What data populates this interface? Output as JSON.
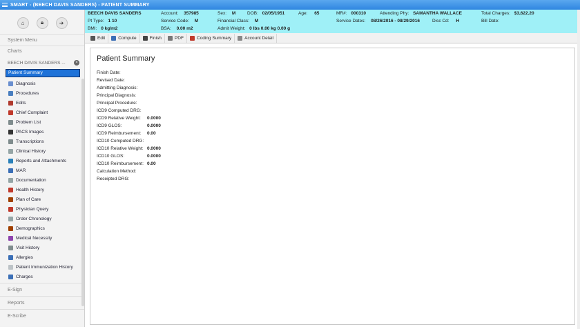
{
  "window": {
    "title": "SMART - (BEECH DAVIS SANDERS) - PATIENT SUMMARY"
  },
  "sidebar": {
    "system_menu": "System Menu",
    "charts": "Charts",
    "patient_name": "BEECH DAVIS SANDERS ...",
    "selected": "Patient Summary",
    "items": [
      {
        "label": "Diagnosis",
        "icon": "diagnosis-icon",
        "color": "#6a8fcf"
      },
      {
        "label": "Procedures",
        "icon": "procedures-icon",
        "color": "#4a7fc0"
      },
      {
        "label": "Edits",
        "icon": "edits-icon",
        "color": "#b03a2e"
      },
      {
        "label": "Chief Complaint",
        "icon": "chief-complaint-icon",
        "color": "#c0392b"
      },
      {
        "label": "Problem List",
        "icon": "problem-list-icon",
        "color": "#7f8c8d"
      },
      {
        "label": "PACS Images",
        "icon": "pacs-images-icon",
        "color": "#333333"
      },
      {
        "label": "Transcriptions",
        "icon": "transcriptions-icon",
        "color": "#7f8c8d"
      },
      {
        "label": "Clinical History",
        "icon": "clinical-history-icon",
        "color": "#95a5a6"
      },
      {
        "label": "Reports and Attachments",
        "icon": "reports-icon",
        "color": "#2980b9"
      },
      {
        "label": "MAR",
        "icon": "mar-icon",
        "color": "#3b6fb6"
      },
      {
        "label": "Documentation",
        "icon": "documentation-icon",
        "color": "#95a5a6"
      },
      {
        "label": "Health History",
        "icon": "health-history-icon",
        "color": "#c0392b"
      },
      {
        "label": "Plan of Care",
        "icon": "plan-of-care-icon",
        "color": "#a04000"
      },
      {
        "label": "Physician Query",
        "icon": "physician-query-icon",
        "color": "#c0392b"
      },
      {
        "label": "Order Chronology",
        "icon": "order-chronology-icon",
        "color": "#95a5a6"
      },
      {
        "label": "Demographics",
        "icon": "demographics-icon",
        "color": "#a04000"
      },
      {
        "label": "Medical Necessity",
        "icon": "medical-necessity-icon",
        "color": "#8e44ad"
      },
      {
        "label": "Visit History",
        "icon": "visit-history-icon",
        "color": "#7f8c8d"
      },
      {
        "label": "Allergies",
        "icon": "allergies-icon",
        "color": "#3b6fb6"
      },
      {
        "label": "Patient Immunization History",
        "icon": "immunization-icon",
        "color": "#bdc3c7"
      },
      {
        "label": "Charges",
        "icon": "charges-icon",
        "color": "#3b6fb6"
      }
    ],
    "bottom": [
      "E-Sign",
      "Reports",
      "E-Scribe"
    ]
  },
  "header": {
    "name": "BEECH DAVIS SANDERS",
    "account_label": "Account:",
    "account": "357985",
    "sex_label": "Sex:",
    "sex": "M",
    "dob_label": "DOB:",
    "dob": "02/05/1951",
    "age_label": "Age:",
    "age": "65",
    "mr_label": "MR#:",
    "mr": "000310",
    "attending_label": "Attending Phy:",
    "attending": "SAMANTHA WALLACE",
    "charges_label": "Total Charges:",
    "charges": "$3,622.20",
    "pt_type_label": "Pt Type:",
    "pt_type": "1  10",
    "service_code_label": "Service Code:",
    "service_code": "M",
    "financial_label": "Financial Class:",
    "financial": "M",
    "service_dates_label": "Service Dates:",
    "service_dates": "08/26/2016 - 08/29/2016",
    "disc_label": "Disc Cd:",
    "disc": "H",
    "bill_date_label": "Bill Date:",
    "bmi_label": "BMI:",
    "bmi": "0 kg/m2",
    "bsa_label": "BSA:",
    "bsa": "0.00 m2",
    "admit_weight_label": "Admit Weight:",
    "admit_weight": "0 lbs 0.00 kg 0.00 g"
  },
  "toolbar": {
    "buttons": [
      {
        "label": "Edit",
        "icon": "edit-icon",
        "color": "#555555"
      },
      {
        "label": "Compute",
        "icon": "compute-icon",
        "color": "#3b6fb6"
      },
      {
        "label": "Finish",
        "icon": "finish-icon",
        "color": "#444444"
      },
      {
        "label": "PDF",
        "icon": "pdf-icon",
        "color": "#777777"
      },
      {
        "label": "Coding Summary",
        "icon": "coding-summary-icon",
        "color": "#c0392b"
      },
      {
        "label": "Account Detail",
        "icon": "account-detail-icon",
        "color": "#888888"
      }
    ]
  },
  "summary": {
    "title": "Patient Summary",
    "fields": [
      {
        "label": "Finish Date:",
        "value": ""
      },
      {
        "label": "Revised Date:",
        "value": ""
      },
      {
        "label": "Admitting Diagnosis:",
        "value": ""
      },
      {
        "label": "Principal Diagnosis:",
        "value": ""
      },
      {
        "label": "Principal Procedure:",
        "value": ""
      },
      {
        "label": "ICD9 Computed DRG:",
        "value": ""
      },
      {
        "label": "ICD9 Relative Weight:",
        "value": "0.0000"
      },
      {
        "label": "ICD9 GLOS:",
        "value": "0.0000"
      },
      {
        "label": "ICD9 Reimbursement:",
        "value": "0.00"
      },
      {
        "label": "ICD10 Computed DRG:",
        "value": ""
      },
      {
        "label": "ICD10 Relative Weight:",
        "value": "0.0000"
      },
      {
        "label": "ICD10 GLOS:",
        "value": "0.0000"
      },
      {
        "label": "ICD10 Reimbursement:",
        "value": "0.00"
      },
      {
        "label": "Calculation Method:",
        "value": ""
      },
      {
        "label": "Receipted DRG:",
        "value": ""
      }
    ]
  }
}
